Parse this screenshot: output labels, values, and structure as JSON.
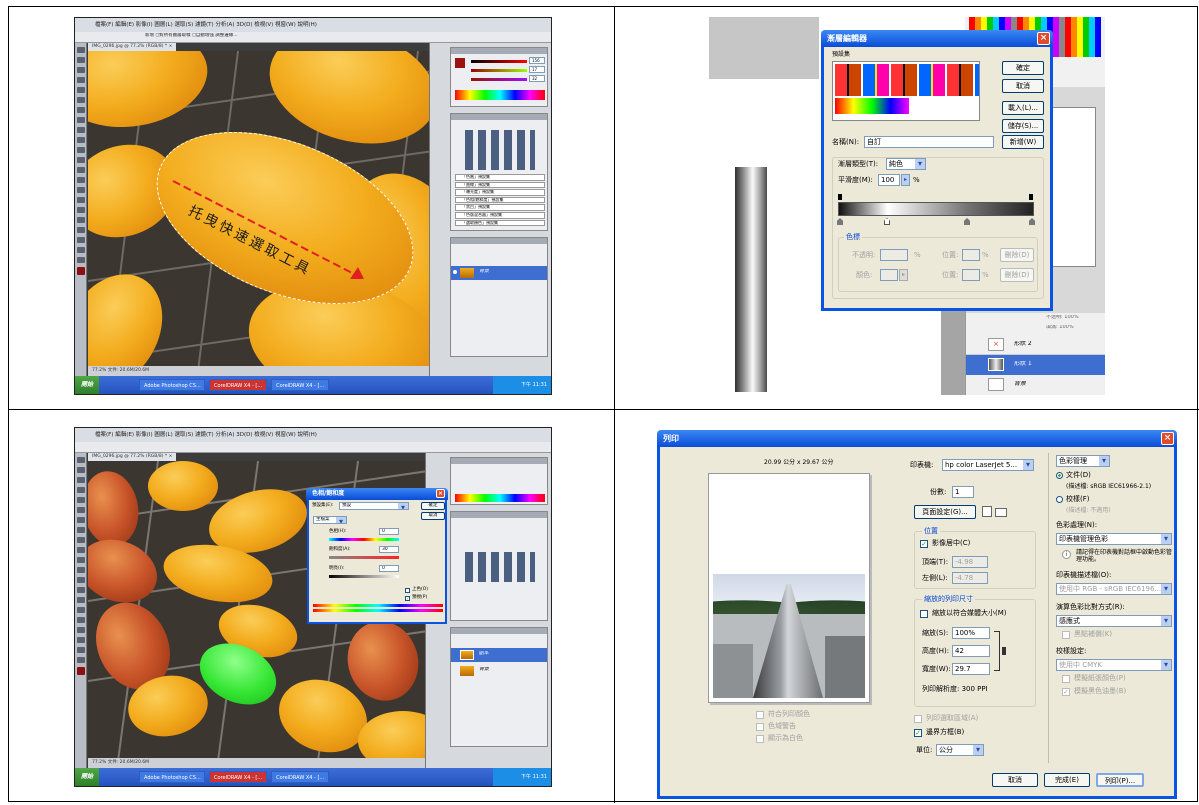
{
  "panel1": {
    "menu": "檔案(F)  編輯(E)  影像(I)  圖層(L)  選取(S)  濾鏡(T)  分析(A)  3D(D)  檢視(V)  視窗(W)  說明(H)",
    "options": "新增  ◻對所有圖層取樣  ◻自動增強  調整邊緣...",
    "doc_tab": "IMG_0296.jpg @ 77.2% (RGB/8) * ×",
    "annotation": "托曳快速選取工具",
    "status": "77.2%  文件: 20.6M/20.6M",
    "panel_items": [
      "「色階」預設集",
      "「曲線」預設集",
      "「曝光度」預設集",
      "「色相/飽和度」預設集",
      "「黑白」預設集",
      "「色版混合器」預設集",
      "「選取顏色」預設集"
    ],
    "layer_name": "背景",
    "taskbar_start": "開始",
    "taskbar_items": [
      "Adobe Photoshop CS...",
      "CorelDRAW X4 - [...",
      "CorelDRAW X4 - [..."
    ],
    "taskbar_time": "下午 11:31",
    "color_values": [
      "156",
      "17",
      "32"
    ]
  },
  "panel2": {
    "title": "漸層編輯器",
    "presets_label": "預設集",
    "buttons": {
      "ok": "確定",
      "cancel": "取消",
      "load": "載入(L)...",
      "save": "儲存(S)...",
      "new": "新增(W)"
    },
    "name_label": "名稱(N):",
    "name_value": "自訂",
    "type_label": "漸層類型(T):",
    "type_value": "純色",
    "smooth_label": "平滑度(M):",
    "smooth_value": "100",
    "smooth_unit": "%",
    "stops_title": "色標",
    "opacity_label": "不透明:",
    "color_label": "顏色:",
    "location_label": "位置:",
    "percent": "%",
    "delete_label": "刪除(D)",
    "layers": [
      "形狀 2",
      "形狀 1",
      "背景"
    ],
    "opacity_readout": "不透明: 100%",
    "fill_readout": "填滿: 100%"
  },
  "panel3": {
    "dialog_title": "色相/飽和度",
    "preset_label": "預設集(E):",
    "preset_value": "預設",
    "channel_value": "主檔案",
    "hue_label": "色相(H):",
    "hue_value": "0",
    "sat_label": "飽和度(A):",
    "sat_value": "30",
    "light_label": "明亮(I):",
    "light_value": "0",
    "ok": "確定",
    "cancel": "取消",
    "colorize": "上色(O)",
    "preview": "預視(P)",
    "layers": [
      "副本",
      "背景"
    ],
    "status": "77.2%  文件: 20.6M/20.6M"
  },
  "panel4": {
    "title": "列印",
    "paper_size": "20.99 公分 x 29.67 公分",
    "printer_label": "印表機:",
    "printer_value": "hp color LaserJet 5...",
    "copies_label": "份數:",
    "copies_value": "1",
    "page_setup": "頁面設定(G)...",
    "position_title": "位置",
    "center_label": "影像居中(C)",
    "top_label": "頂端(T):",
    "top_value": "-4.98",
    "left_label": "左側(L):",
    "left_value": "-4.78",
    "scaled_title": "縮放的列印尺寸",
    "fit_label": "縮放以符合媒體大小(M)",
    "scale_label": "縮放(S):",
    "scale_value": "100%",
    "height_label": "高度(H):",
    "height_value": "42",
    "width_label": "寬度(W):",
    "width_value": "29.7",
    "resolution": "列印解析度: 300 PPI",
    "print_selection": "列印選取區域(A)",
    "bbox": "邊界方框(B)",
    "units_label": "單位:",
    "units_value": "公分",
    "match_colors": "符合列印顏色",
    "gamut_warning": "色域警告",
    "show_white": "顯示為白色",
    "color_mgmt": "色彩管理",
    "document": "文件(D)",
    "doc_profile": "(描述檔: sRGB IEC61966-2.1)",
    "proof": "校樣(F)",
    "proof_profile": "(描述檔: 不適用)",
    "color_handling_label": "色彩處理(N):",
    "color_handling_value": "印表機管理色彩",
    "notice": "請記得在印表機對話框中啟動色彩管理功能。",
    "printer_profile_label": "印表機描述檔(O):",
    "printer_profile_value": "使用中 RGB - sRGB IEC6196...",
    "rendering_label": "演算色彩比對方式(R):",
    "rendering_value": "感應式",
    "bpc": "黑點補償(K)",
    "proof_setup_label": "校樣設定:",
    "proof_setup_value": "使用中 CMYK",
    "sim_paper": "模擬紙張顏色(P)",
    "sim_black": "模擬黑色油墨(B)",
    "cancel": "取消",
    "done": "完成(E)",
    "print": "列印(P)..."
  }
}
